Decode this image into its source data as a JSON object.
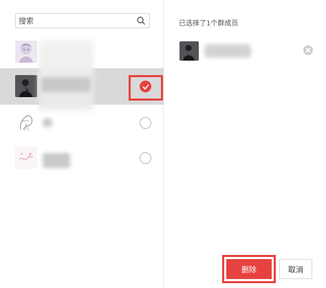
{
  "search": {
    "placeholder": "搜索",
    "icon": "search-icon"
  },
  "members": [
    {
      "avatar": "anime-girl-avatar",
      "selected": false
    },
    {
      "avatar": "dark-person-avatar",
      "selected": true
    },
    {
      "avatar": "sketch-avatar",
      "selected": false
    },
    {
      "avatar": "pink-drawing-avatar",
      "selected": false
    }
  ],
  "selected_panel": {
    "count_text": "已选择了1个群成员",
    "remove_icon": "close-circle-icon"
  },
  "footer": {
    "delete_label": "删除",
    "cancel_label": "取消"
  },
  "colors": {
    "accent": "#e64340",
    "selected_row": "#d9d9d9"
  }
}
